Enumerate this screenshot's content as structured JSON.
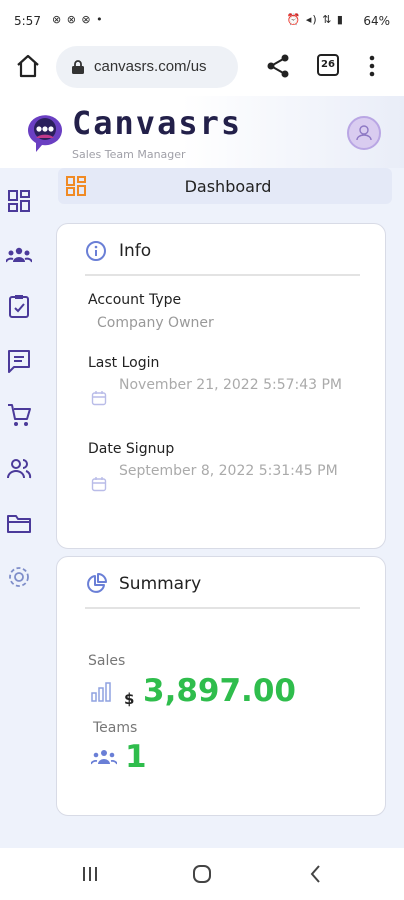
{
  "status_bar": {
    "time": "5:57",
    "left_icons": "⊗ ⊗ ⊗ •",
    "right_icons": "⏰ ◂) ⇅ ▮",
    "battery": "64%"
  },
  "browser": {
    "url": "canvasrs.com/us",
    "tab_count": "26",
    "icons": [
      "home-icon",
      "lock-icon",
      "share-icon",
      "tabs-icon",
      "menu-icon"
    ]
  },
  "app": {
    "brand": "Canvasrs",
    "tagline": "Sales Team Manager"
  },
  "sidebar": {
    "items": [
      "dashboard-icon",
      "teams-icon",
      "tasks-icon",
      "messages-icon",
      "cart-icon",
      "users-icon",
      "folder-icon",
      "settings-icon"
    ]
  },
  "dashboard": {
    "title": "Dashboard"
  },
  "info": {
    "title": "Info",
    "account_type_label": "Account Type",
    "account_type_value": "Company Owner",
    "last_login_label": "Last Login",
    "last_login_value": "November 21, 2022 5:57:43 PM",
    "date_signup_label": "Date Signup",
    "date_signup_value": "September 8, 2022 5:31:45 PM"
  },
  "summary": {
    "title": "Summary",
    "sales_label": "Sales",
    "currency_symbol": "$",
    "sales_value": "3,897.00",
    "teams_label": "Teams",
    "teams_value": "1"
  },
  "colors": {
    "accent_purple": "#6a3fc2",
    "accent_orange": "#f08a24",
    "value_green": "#2fbd4c",
    "background": "#eef2fb"
  }
}
